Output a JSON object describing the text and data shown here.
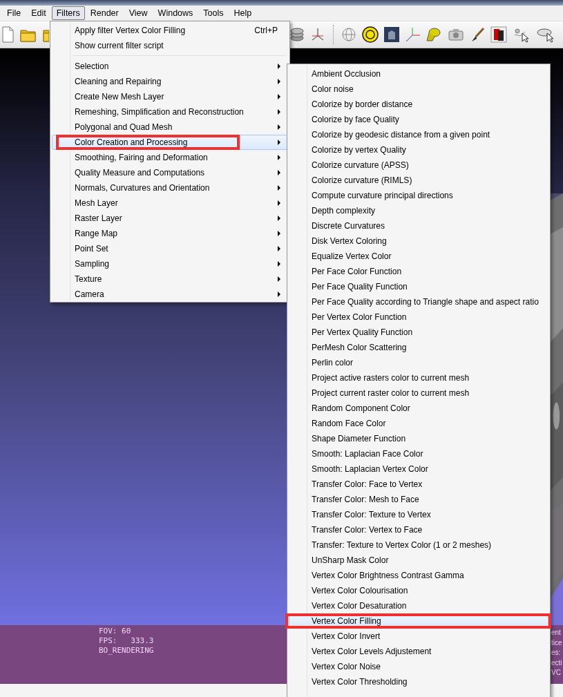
{
  "menu_bar": [
    {
      "label": "File",
      "selected": false
    },
    {
      "label": "Edit",
      "selected": false
    },
    {
      "label": "Filters",
      "selected": true
    },
    {
      "label": "Render",
      "selected": false
    },
    {
      "label": "View",
      "selected": false
    },
    {
      "label": "Windows",
      "selected": false
    },
    {
      "label": "Tools",
      "selected": false
    },
    {
      "label": "Help",
      "selected": false
    }
  ],
  "filters_menu": {
    "items": [
      {
        "kind": "command",
        "label": "Apply filter Vertex Color Filling",
        "shortcut": "Ctrl+P",
        "selected": false,
        "annotated": false
      },
      {
        "kind": "command",
        "label": "Show current filter script",
        "selected": false,
        "annotated": false
      },
      {
        "kind": "separator"
      },
      {
        "kind": "submenu",
        "label": "Selection",
        "selected": false,
        "annotated": false
      },
      {
        "kind": "submenu",
        "label": "Cleaning and Repairing",
        "selected": false,
        "annotated": false
      },
      {
        "kind": "submenu",
        "label": "Create New Mesh Layer",
        "selected": false,
        "annotated": false
      },
      {
        "kind": "submenu",
        "label": "Remeshing, Simplification and Reconstruction",
        "selected": false,
        "annotated": false
      },
      {
        "kind": "submenu",
        "label": "Polygonal and Quad Mesh",
        "selected": false,
        "annotated": false
      },
      {
        "kind": "submenu",
        "label": "Color Creation and Processing",
        "selected": true,
        "annotated": true
      },
      {
        "kind": "submenu",
        "label": "Smoothing, Fairing and Deformation",
        "selected": false,
        "annotated": false
      },
      {
        "kind": "submenu",
        "label": "Quality Measure and Computations",
        "selected": false,
        "annotated": false
      },
      {
        "kind": "submenu",
        "label": "Normals, Curvatures and Orientation",
        "selected": false,
        "annotated": false
      },
      {
        "kind": "submenu",
        "label": "Mesh Layer",
        "selected": false,
        "annotated": false
      },
      {
        "kind": "submenu",
        "label": "Raster Layer",
        "selected": false,
        "annotated": false
      },
      {
        "kind": "submenu",
        "label": "Range Map",
        "selected": false,
        "annotated": false
      },
      {
        "kind": "submenu",
        "label": "Point Set",
        "selected": false,
        "annotated": false
      },
      {
        "kind": "submenu",
        "label": "Sampling",
        "selected": false,
        "annotated": false
      },
      {
        "kind": "submenu",
        "label": "Texture",
        "selected": false,
        "annotated": false
      },
      {
        "kind": "submenu",
        "label": "Camera",
        "selected": false,
        "annotated": false
      }
    ]
  },
  "color_submenu": {
    "items": [
      {
        "label": "Ambient Occlusion",
        "selected": false,
        "annotated": false
      },
      {
        "label": "Color noise",
        "selected": false,
        "annotated": false
      },
      {
        "label": "Colorize by border distance",
        "selected": false,
        "annotated": false
      },
      {
        "label": "Colorize by face Quality",
        "selected": false,
        "annotated": false
      },
      {
        "label": "Colorize by geodesic distance from a given point",
        "selected": false,
        "annotated": false
      },
      {
        "label": "Colorize by vertex Quality",
        "selected": false,
        "annotated": false
      },
      {
        "label": "Colorize curvature (APSS)",
        "selected": false,
        "annotated": false
      },
      {
        "label": "Colorize curvature (RIMLS)",
        "selected": false,
        "annotated": false
      },
      {
        "label": "Compute curvature principal directions",
        "selected": false,
        "annotated": false
      },
      {
        "label": "Depth complexity",
        "selected": false,
        "annotated": false
      },
      {
        "label": "Discrete Curvatures",
        "selected": false,
        "annotated": false
      },
      {
        "label": "Disk Vertex Coloring",
        "selected": false,
        "annotated": false
      },
      {
        "label": "Equalize Vertex Color",
        "selected": false,
        "annotated": false
      },
      {
        "label": "Per Face Color Function",
        "selected": false,
        "annotated": false
      },
      {
        "label": "Per Face Quality Function",
        "selected": false,
        "annotated": false
      },
      {
        "label": "Per Face Quality according to Triangle shape and aspect ratio",
        "selected": false,
        "annotated": false
      },
      {
        "label": "Per Vertex Color Function",
        "selected": false,
        "annotated": false
      },
      {
        "label": "Per Vertex Quality Function",
        "selected": false,
        "annotated": false
      },
      {
        "label": "PerMesh Color Scattering",
        "selected": false,
        "annotated": false
      },
      {
        "label": "Perlin color",
        "selected": false,
        "annotated": false
      },
      {
        "label": "Project active rasters color to current mesh",
        "selected": false,
        "annotated": false
      },
      {
        "label": "Project current raster color to current mesh",
        "selected": false,
        "annotated": false
      },
      {
        "label": "Random Component Color",
        "selected": false,
        "annotated": false
      },
      {
        "label": "Random Face Color",
        "selected": false,
        "annotated": false
      },
      {
        "label": "Shape Diameter Function",
        "selected": false,
        "annotated": false
      },
      {
        "label": "Smooth: Laplacian Face Color",
        "selected": false,
        "annotated": false
      },
      {
        "label": "Smooth: Laplacian Vertex Color",
        "selected": false,
        "annotated": false
      },
      {
        "label": "Transfer Color: Face to Vertex",
        "selected": false,
        "annotated": false
      },
      {
        "label": "Transfer Color: Mesh to Face",
        "selected": false,
        "annotated": false
      },
      {
        "label": "Transfer Color: Texture to Vertex",
        "selected": false,
        "annotated": false
      },
      {
        "label": "Transfer Color: Vertex to Face",
        "selected": false,
        "annotated": false
      },
      {
        "label": "Transfer: Texture to Vertex Color (1 or 2 meshes)",
        "selected": false,
        "annotated": false
      },
      {
        "label": "UnSharp Mask Color",
        "selected": false,
        "annotated": false
      },
      {
        "label": "Vertex Color Brightness Contrast Gamma",
        "selected": false,
        "annotated": false
      },
      {
        "label": "Vertex Color Colourisation",
        "selected": false,
        "annotated": false
      },
      {
        "label": "Vertex Color Desaturation",
        "selected": false,
        "annotated": false
      },
      {
        "label": "Vertex Color Filling",
        "selected": true,
        "annotated": true
      },
      {
        "label": "Vertex Color Invert",
        "selected": false,
        "annotated": false
      },
      {
        "label": "Vertex Color Levels Adjustement",
        "selected": false,
        "annotated": false
      },
      {
        "label": "Vertex Color Noise",
        "selected": false,
        "annotated": false
      },
      {
        "label": "Vertex Color Thresholding",
        "selected": false,
        "annotated": false
      }
    ]
  },
  "viewport": {
    "kind": "picture",
    "info_lines": [
      "FOV: 60",
      "FPS:   333.3",
      "BO_RENDERING"
    ],
    "side_info_lines": [
      "ent",
      "tice",
      "es:",
      "ecti",
      "VC"
    ]
  }
}
